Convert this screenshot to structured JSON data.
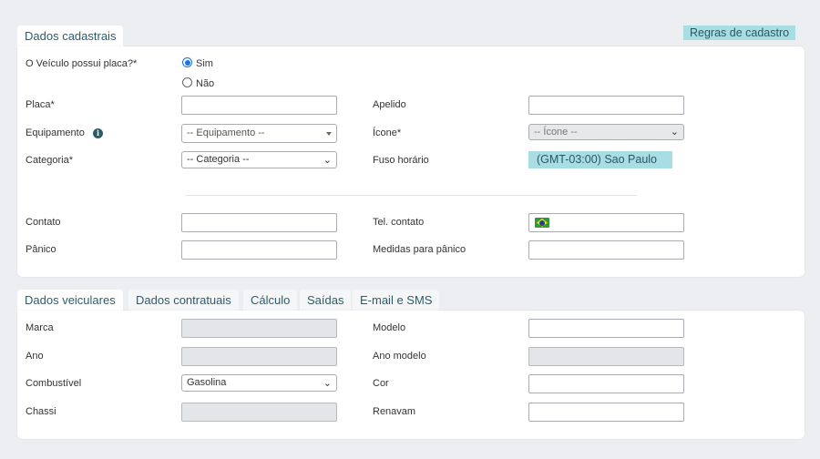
{
  "tabs_top": [
    {
      "label": "Dados cadastrais"
    }
  ],
  "rules_button": "Regras de cadastro",
  "cadastro": {
    "has_plate_label": "O Veículo possui placa?*",
    "radio_yes": "Sim",
    "radio_no": "Não",
    "selected": "Sim",
    "plate_label": "Placa*",
    "plate_value": "",
    "nickname_label": "Apelido",
    "nickname_value": "",
    "equipment_label": "Equipamento",
    "equipment_placeholder": "-- Equipamento --",
    "icon_label": "Ícone*",
    "icon_placeholder": "-- Ícone --",
    "category_label": "Categoria*",
    "category_placeholder": "-- Categoria --",
    "timezone_label": "Fuso horário",
    "timezone_value": "(GMT-03:00) Sao Paulo",
    "contact_label": "Contato",
    "contact_value": "",
    "phone_label": "Tel. contato",
    "phone_value": "",
    "panic_label": "Pânico",
    "panic_value": "",
    "panic_measures_label": "Medidas para pânico",
    "panic_measures_value": ""
  },
  "tabs_bottom": [
    {
      "label": "Dados veiculares"
    },
    {
      "label": "Dados contratuais"
    },
    {
      "label": "Cálculo"
    },
    {
      "label": "Saídas"
    },
    {
      "label": "E-mail e SMS"
    }
  ],
  "veiculares": {
    "brand_label": "Marca",
    "model_label": "Modelo",
    "year_label": "Ano",
    "model_year_label": "Ano modelo",
    "fuel_label": "Combustível",
    "fuel_value": "Gasolina",
    "color_label": "Cor",
    "chassis_label": "Chassi",
    "renavam_label": "Renavam"
  },
  "colors": {
    "accent": "#a8dde3",
    "tab_text": "#2d5c69",
    "background": "#eceef1",
    "radio_selected": "#1a73e8",
    "disabled_field": "#e3e5e9"
  },
  "icons": {
    "info": "info-circle-icon",
    "dropdown": "chevron-down-icon",
    "flag": "brazil-flag-icon"
  }
}
